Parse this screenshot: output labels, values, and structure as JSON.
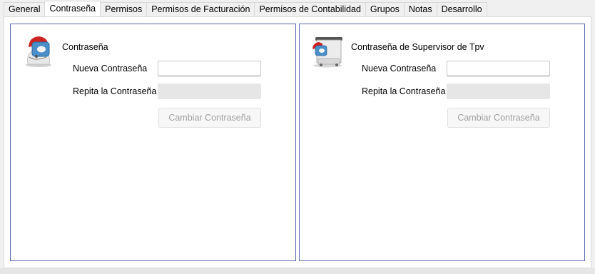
{
  "tabs": [
    {
      "label": "General"
    },
    {
      "label": "Contraseña",
      "active": true
    },
    {
      "label": "Permisos"
    },
    {
      "label": "Permisos de Facturación"
    },
    {
      "label": "Permisos de Contabilidad"
    },
    {
      "label": "Grupos"
    },
    {
      "label": "Notas"
    },
    {
      "label": "Desarrollo"
    }
  ],
  "left_panel": {
    "icon": "user-password-icon",
    "title": "Contraseña",
    "new_password_label": "Nueva Contraseña",
    "new_password_value": "",
    "repeat_password_label": "Repita la Contraseña",
    "repeat_password_value": "",
    "change_button": "Cambiar Contraseña"
  },
  "right_panel": {
    "icon": "pos-terminal-icon",
    "title": "Contraseña de Supervisor de Tpv",
    "new_password_label": "Nueva Contraseña",
    "new_password_value": "",
    "repeat_password_label": "Repita la Contraseña",
    "repeat_password_value": "",
    "change_button": "Cambiar Contraseña"
  },
  "colors": {
    "panel_border": "#5a6bb0",
    "disabled_text": "#a0a0a0"
  }
}
